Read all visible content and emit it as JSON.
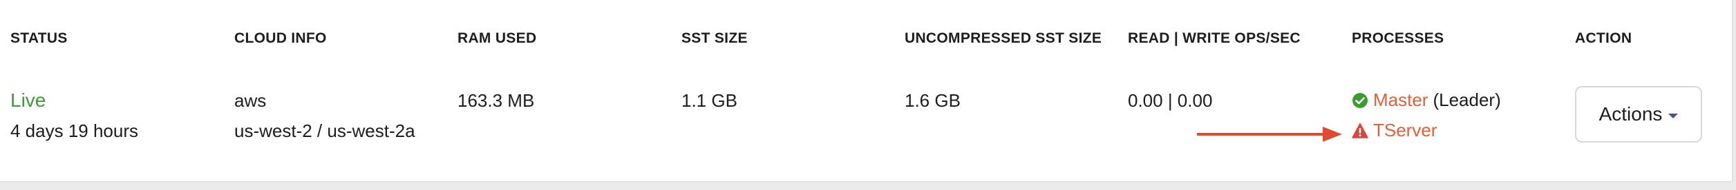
{
  "colors": {
    "live": "#3d9b35",
    "process_link": "#e0603a",
    "check_icon": "#3d9b35",
    "warning_icon": "#d9463e",
    "arrow": "#e04a2e",
    "caret": "#3a53a4"
  },
  "table": {
    "headers": {
      "status": "STATUS",
      "cloud_info": "CLOUD INFO",
      "ram_used": "RAM USED",
      "sst_size": "SST SIZE",
      "uncompressed_sst_size": "UNCOMPRESSED SST SIZE",
      "read_write_ops": "READ | WRITE OPS/SEC",
      "processes": "PROCESSES",
      "action": "ACTION"
    },
    "row": {
      "status": "Live",
      "uptime": "4 days 19 hours",
      "cloud_provider": "aws",
      "cloud_region": "us-west-2 / us-west-2a",
      "ram_used": "163.3 MB",
      "sst_size": "1.1 GB",
      "uncompressed_sst_size": "1.6 GB",
      "read_write_ops": "0.00 | 0.00",
      "processes": [
        {
          "name": "Master",
          "role": "(Leader)",
          "status_icon": "check-circle-icon"
        },
        {
          "name": "TServer",
          "role": "",
          "status_icon": "warning-triangle-icon"
        }
      ],
      "action_label": "Actions"
    }
  },
  "annotation": {
    "arrow_icon": "arrow-right-icon",
    "points_to": "TServer"
  }
}
